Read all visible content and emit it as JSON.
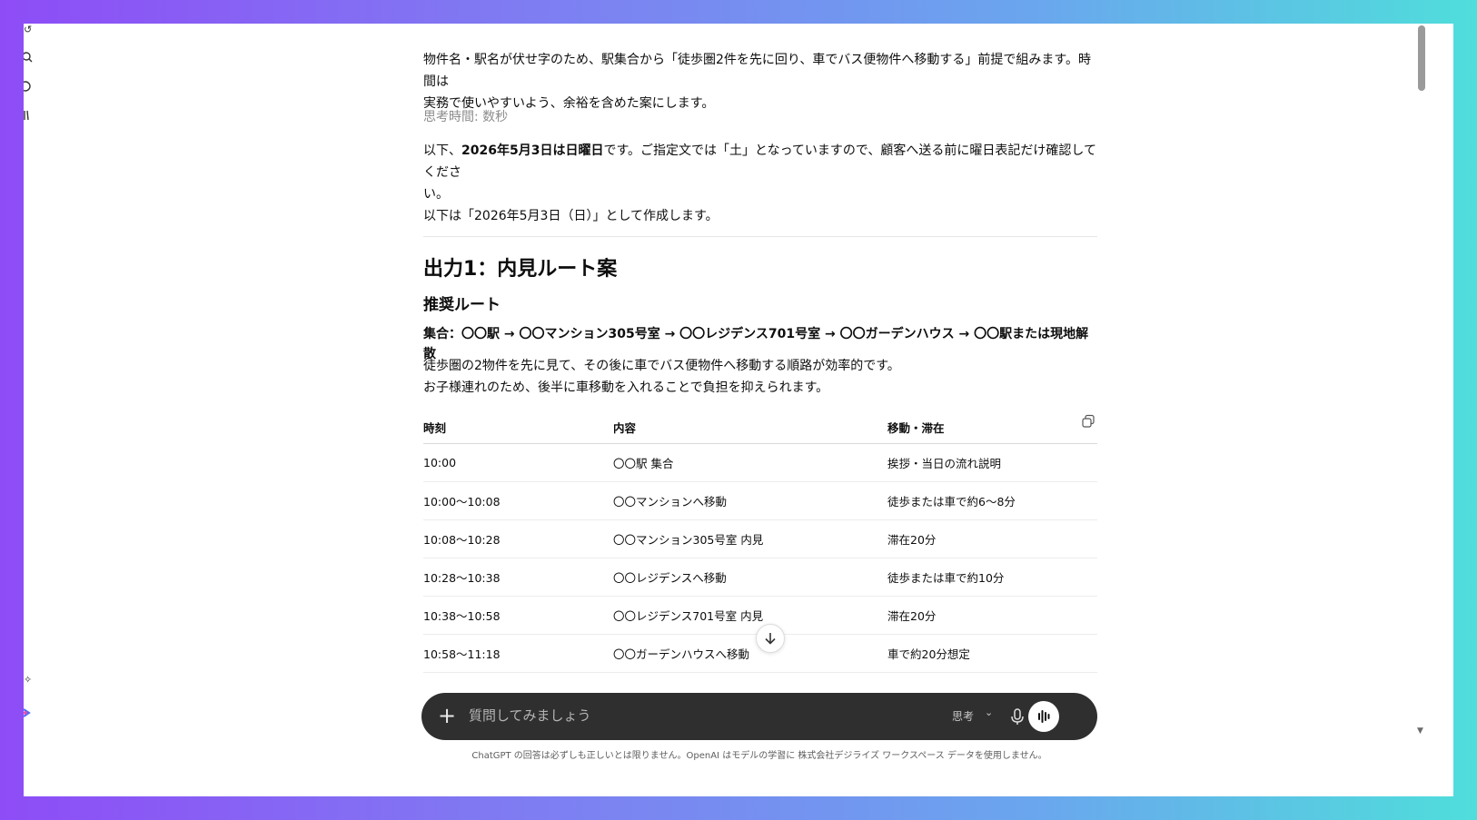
{
  "intro": {
    "line1": "物件名・駅名が伏せ字のため、駅集合から「徒歩圏2件を先に回り、車でバス便物件へ移動する」前提で組みます。時間は",
    "line2": "実務で使いやすいよう、余裕を含めた案にします。"
  },
  "thinking_time": "思考時間: 数秒",
  "note": {
    "prefix": "以下、",
    "bold": "2026年5月3日は日曜日",
    "suffix": "です。ご指定文では「土」となっていますので、顧客へ送る前に曜日表記だけ確認してくださ",
    "wrap": "い。",
    "line3": "以下は「2026年5月3日（日）」として作成します。"
  },
  "section_title": "出力1：内見ルート案",
  "subsection_title": "推奨ルート",
  "route": "集合：〇〇駅 → 〇〇マンション305号室 → 〇〇レジデンス701号室 → 〇〇ガーデンハウス → 〇〇駅または現地解散",
  "desc": {
    "line1": "徒歩圏の2物件を先に見て、その後に車でバス便物件へ移動する順路が効率的です。",
    "line2": "お子様連れのため、後半に車移動を入れることで負担を抑えられます。"
  },
  "table": {
    "headers": [
      "時刻",
      "内容",
      "移動・滞在"
    ],
    "rows": [
      [
        "10:00",
        "〇〇駅 集合",
        "挨拶・当日の流れ説明"
      ],
      [
        "10:00〜10:08",
        "〇〇マンションへ移動",
        "徒歩または車で約6〜8分"
      ],
      [
        "10:08〜10:28",
        "〇〇マンション305号室 内見",
        "滞在20分"
      ],
      [
        "10:28〜10:38",
        "〇〇レジデンスへ移動",
        "徒歩または車で約10分"
      ],
      [
        "10:38〜10:58",
        "〇〇レジデンス701号室 内見",
        "滞在20分"
      ],
      [
        "10:58〜11:18",
        "〇〇ガーデンハウスへ移動",
        "車で約20分想定"
      ]
    ]
  },
  "composer": {
    "placeholder": "質問してみましょう",
    "mode_label": "思考"
  },
  "disclaimer": "ChatGPT の回答は必ずしも正しいとは限りません。OpenAI はモデルの学習に 株式会社デジライズ ワークスペース データを使用しません。",
  "icons": {
    "copy": "copy-icon",
    "scroll_down": "arrow-down-icon",
    "plus": "plus-icon",
    "mic": "microphone-icon",
    "voice": "voice-mode-icon",
    "chevron": "chevron-down-icon"
  }
}
